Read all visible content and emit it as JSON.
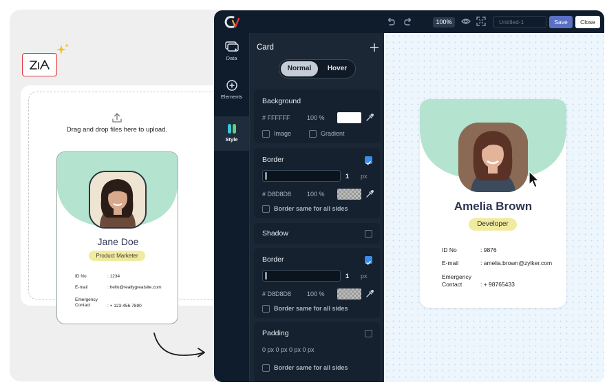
{
  "promo": {
    "upload_text": "Drag and drop files here to upload.",
    "card": {
      "name": "Jane Doe",
      "role": "Product Marketer",
      "fields": [
        {
          "label": "ID No",
          "value": ": 1234"
        },
        {
          "label": "E-mail",
          "value": ": hello@reallygreatsite.com"
        },
        {
          "label": "Emergency\nContact",
          "value": ": + 123-456-7890"
        }
      ]
    }
  },
  "toolbar": {
    "zoom": "100%",
    "title_placeholder": "Untitled-1",
    "save_label": "Save",
    "close_label": "Close"
  },
  "rail": {
    "items": [
      {
        "label": "Data",
        "icon": "data-icon"
      },
      {
        "label": "Elements",
        "icon": "plus-circle-icon"
      },
      {
        "label": "Style",
        "icon": "style-icon"
      }
    ]
  },
  "panel": {
    "title": "Card",
    "toggle": {
      "normal": "Normal",
      "hover": "Hover",
      "selected": "Normal"
    },
    "background": {
      "title": "Background",
      "hex": "# FFFFFF",
      "opacity": "100 %",
      "color": "#ffffff",
      "image_label": "Image",
      "gradient_label": "Gradient"
    },
    "border1": {
      "title": "Border",
      "checked": true,
      "width": "1",
      "unit": "px",
      "hex": "# D8D8D8",
      "opacity": "100 %",
      "same_sides_label": "Border same for all sides"
    },
    "shadow": {
      "title": "Shadow",
      "checked": false
    },
    "border2": {
      "title": "Border",
      "checked": true,
      "width": "1",
      "unit": "px",
      "hex": "# D8D8D8",
      "opacity": "100 %",
      "same_sides_label": "Border same for all sides"
    },
    "padding": {
      "title": "Padding",
      "checked": false,
      "values": "0 px 0 px 0 px 0 px",
      "same_sides_label": "Border same for all sides"
    }
  },
  "preview": {
    "name": "Amelia Brown",
    "role": "Developer",
    "fields": [
      {
        "label": "ID No",
        "value": ": 9876"
      },
      {
        "label": "E-mail",
        "value": ": amelia.brown@zylker.com"
      },
      {
        "label": "Emergency\nContact",
        "value": ": + 98765433"
      }
    ]
  },
  "colors": {
    "accent": "#5b6fc4",
    "mint": "#b4e3cf",
    "badge": "#f1eba0",
    "dark": "#0f1c2c"
  }
}
